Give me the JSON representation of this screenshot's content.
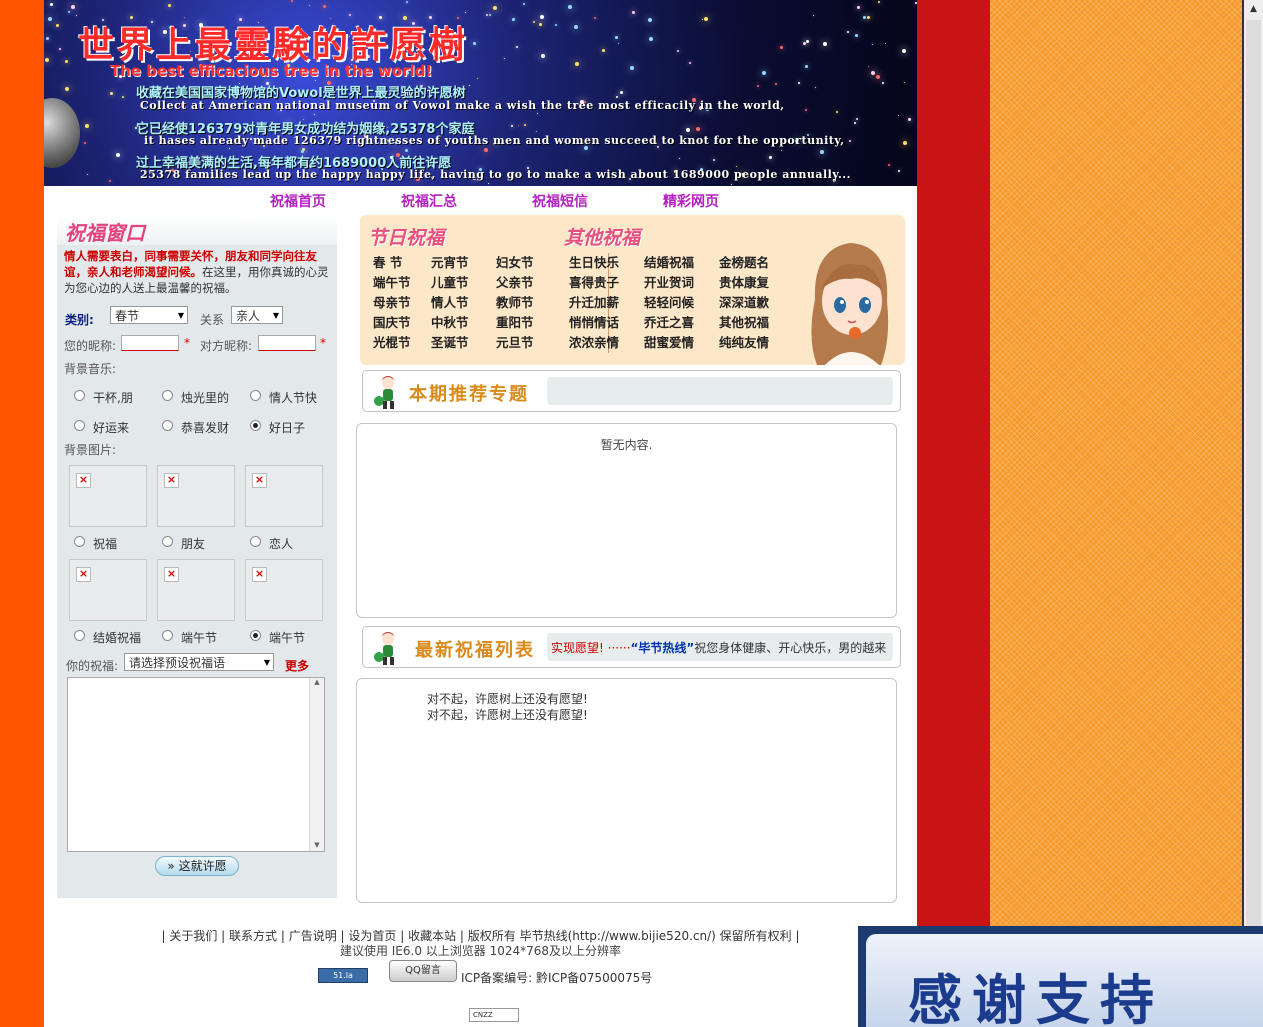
{
  "banner": {
    "title": "世界上最靈験的許愿樹",
    "subtitle": "The best efficacious tree in the world!",
    "line1_zh": "收藏在美国国家博物馆的Vowol是世界上最灵验的许愿树",
    "line1_en": "Collect at American national museum of Vowol make a wish the tree most efficacily in the world,",
    "line2_zh": "它已经使126379对青年男女成功结为姻缘,25378个家庭",
    "line2_en": "it hases already made 126379 rightnesses of youths men and women succeed to knot for the opportunity,",
    "line3_zh": "过上幸福美满的生活,每年都有约1689000人前往许愿",
    "line3_en": "25378 families lead up the happy happy life, having to go to make a wish about 1689000 people annually..."
  },
  "nav": [
    "祝福首页",
    "祝福汇总",
    "祝福短信",
    "精彩网页"
  ],
  "form": {
    "title": "祝福窗口",
    "intro_red": "情人需要表白，同事需要关怀，朋友和同学向往友谊，亲人和老师渴望问候。",
    "intro_rest": "在这里，用你真诚的心灵为您心边的人送上最温馨的祝福。",
    "category_label": "类别:",
    "category_value": "春节",
    "relation_label": "关系",
    "relation_value": "亲人",
    "nickname_label": "您的昵称:",
    "other_nickname_label": "对方昵称:",
    "required_mark": "*",
    "music_label": "背景音乐:",
    "music_options": [
      "干杯,朋",
      "烛光里的",
      "情人节快",
      "好运来",
      "恭喜发财",
      "好日子"
    ],
    "music_selected": "好日子",
    "image_label": "背景图片:",
    "image_options": [
      "祝福",
      "朋友",
      "恋人",
      "结婚祝福",
      "端午节",
      "端午节"
    ],
    "image_selected_index": 5,
    "wish_label": "你的祝福:",
    "wish_select": "请选择预设祝福语",
    "more_label": "更多",
    "submit_label": "» 这就许愿"
  },
  "categories": {
    "festival_title": "节日祝福",
    "other_title": "其他祝福",
    "festival": [
      [
        "春 节",
        "元宵节",
        "妇女节"
      ],
      [
        "端午节",
        "儿童节",
        "父亲节"
      ],
      [
        "母亲节",
        "情人节",
        "教师节"
      ],
      [
        "国庆节",
        "中秋节",
        "重阳节"
      ],
      [
        "光棍节",
        "圣诞节",
        "元旦节"
      ]
    ],
    "other": [
      [
        "生日快乐",
        "结婚祝福",
        "金榜题名"
      ],
      [
        "喜得贵子",
        "开业贺词",
        "贵体康复"
      ],
      [
        "升迁加薪",
        "轻轻问候",
        "深深道歉"
      ],
      [
        "悄悄情话",
        "乔迁之喜",
        "其他祝福"
      ],
      [
        "浓浓亲情",
        "甜蜜爱情",
        "纯纯友情"
      ]
    ]
  },
  "featured": {
    "title": "本期推荐专题",
    "empty_text": "暂无内容."
  },
  "latest": {
    "title": "最新祝福列表",
    "marquee_red": "实现愿望! ······",
    "marquee_blue": "“毕节热线”",
    "marquee_tail": "祝您身体健康、开心快乐，男的越来",
    "messages": [
      "对不起，许愿树上还没有愿望!",
      "对不起，许愿树上还没有愿望!"
    ]
  },
  "footer": {
    "links": [
      "关于我们",
      "联系方式",
      "广告说明",
      "设为首页",
      "收藏本站"
    ],
    "copyright": "版权所有 毕节热线(http://www.bijie520.cn/) 保留所有权利",
    "note": "建议使用 IE6.0 以上浏览器 1024*768及以上分辨率",
    "badge_51la": "51.la",
    "badge_qq": "QQ留言",
    "icp": "ICP备案编号:  黔ICP备07500075号",
    "badge_cnzz": "CNZZ"
  },
  "thanks_banner": "感谢支持",
  "colors": {
    "nav": "#b322c0",
    "accent_red": "#cc0000",
    "panel_bg": "#e3e8ea",
    "section_title": "#d98a1a",
    "bg_left": "#ff5500",
    "bg_red": "#c81414",
    "bg_orange": "#f59a2a"
  },
  "icons": [
    "browser-scrollbar",
    "wish-boy-icon",
    "broken-image-icon",
    "radio-icon",
    "dropdown-arrow-icon"
  ]
}
